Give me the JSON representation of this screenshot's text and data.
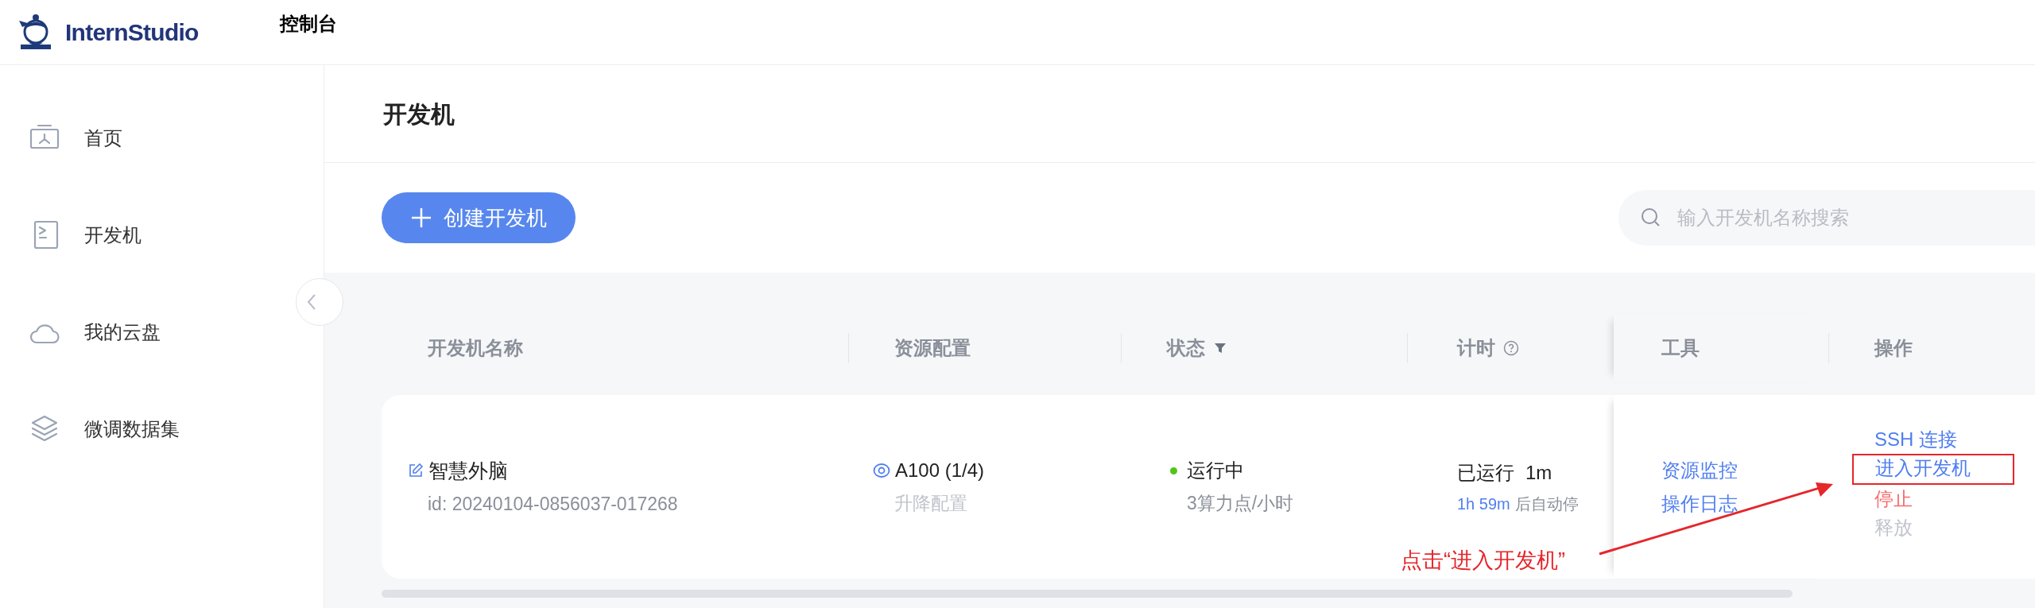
{
  "header": {
    "brand": "InternStudio",
    "title": "控制台"
  },
  "sidebar": {
    "items": [
      {
        "label": "首页",
        "kind": "home"
      },
      {
        "label": "开发机",
        "kind": "terminal"
      },
      {
        "label": "我的云盘",
        "kind": "cloud"
      },
      {
        "label": "微调数据集",
        "kind": "layers"
      }
    ]
  },
  "page": {
    "title": "开发机",
    "create_button": "创建开发机",
    "search": {
      "placeholder": "输入开发机名称搜索"
    }
  },
  "table": {
    "columns": [
      {
        "label": "开发机名称",
        "kind": "plain"
      },
      {
        "label": "资源配置",
        "kind": "plain"
      },
      {
        "label": "状态",
        "kind": "filterable"
      },
      {
        "label": "计时",
        "kind": "info"
      },
      {
        "label": "工具",
        "kind": "plain"
      },
      {
        "label": "操作",
        "kind": "plain"
      }
    ],
    "rows": [
      {
        "name": "智慧外脑",
        "id": "id: 20240104-0856037-017268",
        "gpu": "A100 (1/4)",
        "gpu_action": "升降配置",
        "status": "运行中",
        "color": "#52c41a",
        "rate": "3算力点/小时",
        "timer_label": "已运行",
        "timer_value": "1m",
        "countdown": "1h 59m",
        "countdown_suffix": "后自动停",
        "tools": [
          "资源监控",
          "操作日志"
        ],
        "actions": [
          {
            "label": "SSH 连接",
            "kind": "link",
            "highlighted": false
          },
          {
            "label": "进入开发机",
            "kind": "link",
            "highlighted": true
          },
          {
            "label": "停止",
            "kind": "danger",
            "highlighted": false
          },
          {
            "label": "释放",
            "kind": "disabled",
            "highlighted": false
          }
        ]
      }
    ]
  },
  "annotation": {
    "text": "点击“进入开发机”"
  }
}
